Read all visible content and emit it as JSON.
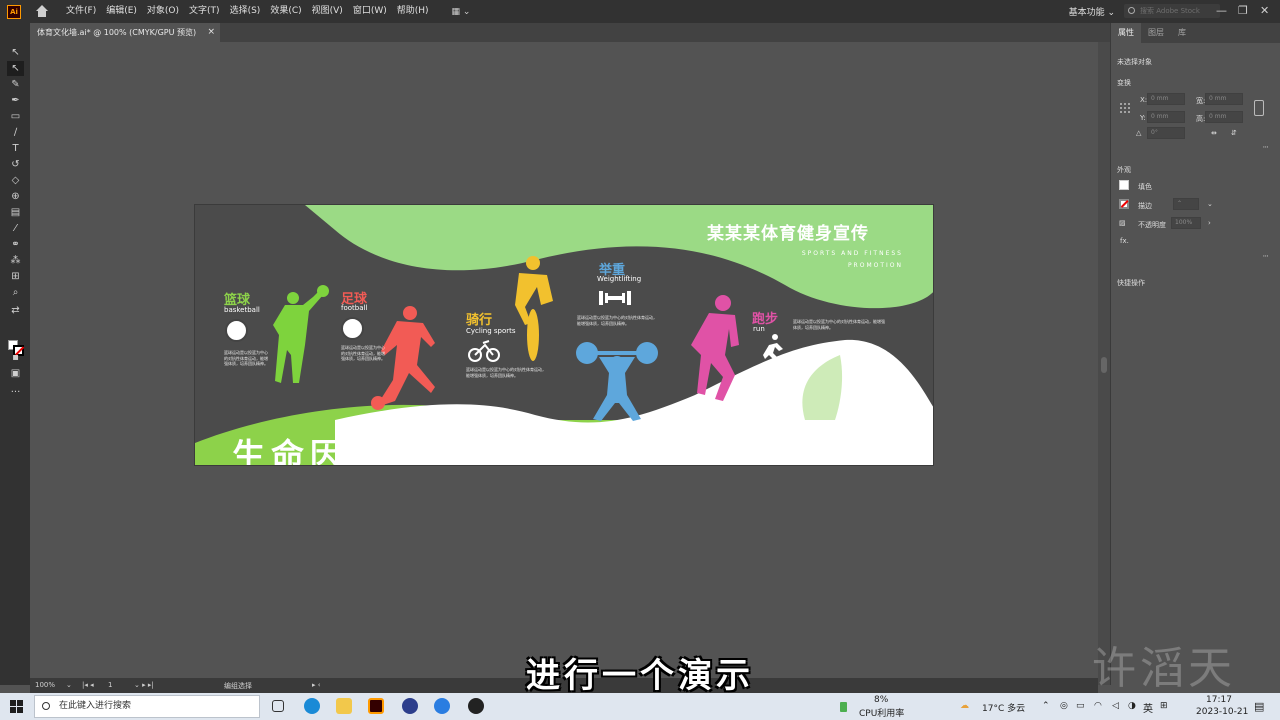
{
  "app": {
    "logo": "Ai",
    "menu": [
      "文件(F)",
      "编辑(E)",
      "对象(O)",
      "文字(T)",
      "选择(S)",
      "效果(C)",
      "视图(V)",
      "窗口(W)",
      "帮助(H)"
    ],
    "workspace": "基本功能",
    "stock_search_placeholder": "搜索 Adobe Stock",
    "window_controls": [
      "—",
      "❐",
      "✕"
    ]
  },
  "document_tab": {
    "title": "体育文化墙.ai* @ 100% (CMYK/GPU 预览)",
    "close": "×"
  },
  "properties_panel": {
    "tabs": [
      "属性",
      "图层",
      "库"
    ],
    "no_selection": "未选择对象",
    "transform_label": "变换",
    "x_label": "X:",
    "y_label": "Y:",
    "w_label": "宽:",
    "h_label": "高:",
    "x_value": "0 mm",
    "y_value": "0 mm",
    "w_value": "0 mm",
    "h_value": "0 mm",
    "angle_label": "△",
    "angle_value": "0°",
    "appearance_label": "外观",
    "fill_label": "填色",
    "stroke_label": "描边",
    "opacity_label": "不透明度",
    "opacity_value": "100%",
    "fx_label": "fx.",
    "quick_actions": "快捷操作"
  },
  "artwork": {
    "title": "某某某体育健身宣传",
    "subtitle_line1": "SPORTS AND FITNESS",
    "subtitle_line2": "PROMOTION",
    "slogan": "生命因运动精彩  体育让梦想成真",
    "sports": [
      {
        "cn": "篮球",
        "en": "basketball",
        "color": "#8dd24a"
      },
      {
        "cn": "足球",
        "en": "football",
        "color": "#f25b55"
      },
      {
        "cn": "骑行",
        "en": "Cycling sports",
        "color": "#f2c12e"
      },
      {
        "cn": "举重",
        "en": "Weightlifting",
        "color": "#5ea7dc"
      },
      {
        "cn": "跑步",
        "en": "run",
        "color": "#e052a6"
      }
    ],
    "desc_text": "篮球运动是以投篮为中心的对抗性体育运动，能增强体质，培养团队精神。"
  },
  "status_bar": {
    "zoom": "100%",
    "artboard_index": "1",
    "tool_name": "编组选择"
  },
  "subtitle": "进行一个演示",
  "watermark": "许滔天",
  "taskbar": {
    "search_placeholder": "在此键入进行搜索",
    "cpu_percent": "8%",
    "cpu_label": "CPU利用率",
    "weather": "17°C 多云",
    "ime": "英",
    "time": "17:17",
    "date": "2023-10-21"
  }
}
